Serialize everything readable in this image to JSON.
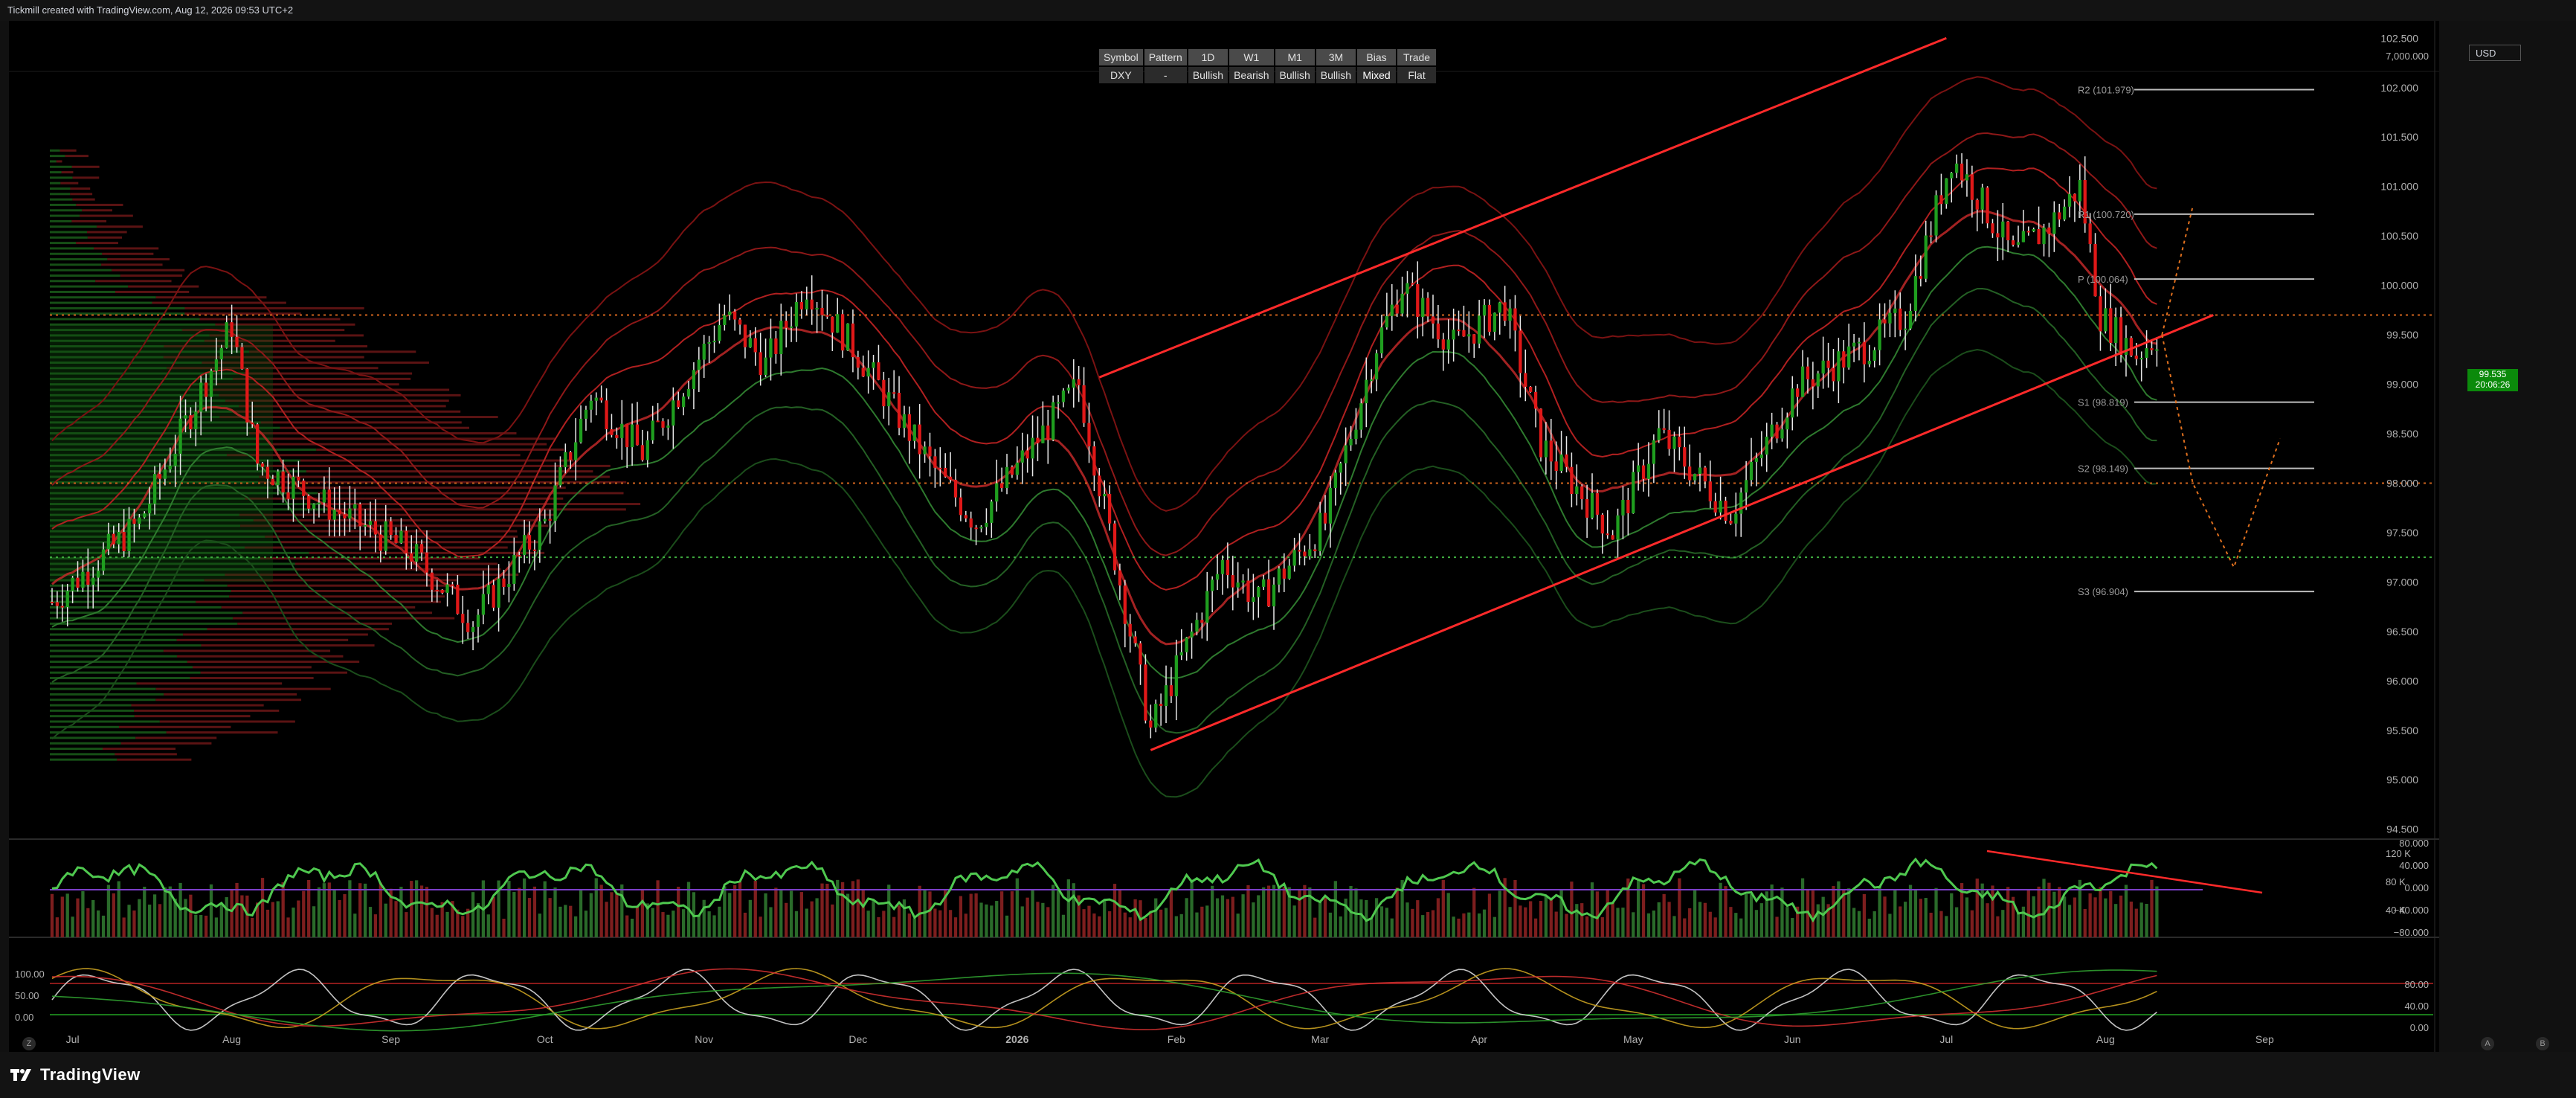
{
  "header": {
    "text": "Tickmill created with TradingView.com, Aug 12, 2026 09:53 UTC+2"
  },
  "table": {
    "headers": [
      "Symbol",
      "Pattern",
      "1D",
      "W1",
      "M1",
      "3M",
      "Bias",
      "Trade"
    ],
    "values": [
      "DXY",
      "-",
      "Bullish",
      "Bearish",
      "Bullish",
      "Bullish",
      "Mixed",
      "Flat"
    ],
    "value_status": [
      "neutral",
      "neutral",
      "bull",
      "bear",
      "bull",
      "bull",
      "mixed",
      "neutral"
    ]
  },
  "price_axis": {
    "currency": "USD",
    "top_label": "7,000.000",
    "ticks": [
      "102.500",
      "102.000",
      "101.500",
      "101.000",
      "100.500",
      "100.000",
      "99.500",
      "99.000",
      "98.500",
      "98.000",
      "97.500",
      "97.000",
      "96.500",
      "96.000",
      "95.500",
      "95.000",
      "94.500"
    ],
    "current_price": "99.535",
    "countdown": "20:06:26"
  },
  "pivots": [
    {
      "label": "R2 (101.979)",
      "value": 101.979
    },
    {
      "label": "R1 (100.720)",
      "value": 100.72
    },
    {
      "label": "P (100.064)",
      "value": 100.064
    },
    {
      "label": "S1 (98.819)",
      "value": 98.819
    },
    {
      "label": "S2 (98.149)",
      "value": 98.149
    },
    {
      "label": "S3 (96.904)",
      "value": 96.904
    }
  ],
  "volume_axis": {
    "ticks": [
      "120 K",
      "80 K",
      "40 K"
    ]
  },
  "rsi_axis": {
    "ticks": [
      "80.000",
      "40.000",
      "0.000",
      "−40.000",
      "−80.000"
    ]
  },
  "stoch_axis": {
    "left_ticks": [
      "100.00",
      "50.00",
      "0.00"
    ],
    "right_ticks": [
      "80.00",
      "40.00",
      "0.00"
    ]
  },
  "time_axis": {
    "labels": [
      "Jul",
      "Aug",
      "Sep",
      "Oct",
      "Nov",
      "Dec",
      "2026",
      "Feb",
      "Mar",
      "Apr",
      "May",
      "Jun",
      "Jul",
      "Aug",
      "Sep"
    ]
  },
  "footer": {
    "brand": "TradingView",
    "z_button": "Z",
    "a_button": "A",
    "b_button": "B"
  },
  "colors": {
    "bull": "#1f9e1f",
    "bear": "#e01818",
    "channel": "#ff2a2a",
    "hline_orange": "#d0641e",
    "hline_green": "#3fae3f",
    "pivot_line": "#9a9a9a",
    "bg": "#000000"
  },
  "chart_data": {
    "type": "candlestick",
    "symbol": "DXY",
    "xlabel": "",
    "ylabel": "",
    "ylim": [
      94.4,
      102.6
    ],
    "last_price": 99.535,
    "close_path": [
      {
        "date": "2025-06-27",
        "close": 96.8
      },
      {
        "date": "2025-07-14",
        "close": 97.6
      },
      {
        "date": "2025-08-01",
        "close": 99.6
      },
      {
        "date": "2025-08-06",
        "close": 98.2
      },
      {
        "date": "2025-08-22",
        "close": 97.7
      },
      {
        "date": "2025-09-05",
        "close": 97.3
      },
      {
        "date": "2025-09-17",
        "close": 96.6
      },
      {
        "date": "2025-10-01",
        "close": 97.6
      },
      {
        "date": "2025-10-10",
        "close": 98.9
      },
      {
        "date": "2025-10-20",
        "close": 98.3
      },
      {
        "date": "2025-11-05",
        "close": 99.7
      },
      {
        "date": "2025-11-13",
        "close": 99.2
      },
      {
        "date": "2025-11-21",
        "close": 100.0
      },
      {
        "date": "2025-12-01",
        "close": 99.3
      },
      {
        "date": "2025-12-15",
        "close": 98.2
      },
      {
        "date": "2025-12-24",
        "close": 97.6
      },
      {
        "date": "2026-01-13",
        "close": 99.0
      },
      {
        "date": "2026-01-27",
        "close": 95.5
      },
      {
        "date": "2026-02-10",
        "close": 97.2
      },
      {
        "date": "2026-02-17",
        "close": 96.8
      },
      {
        "date": "2026-03-02",
        "close": 97.6
      },
      {
        "date": "2026-03-12",
        "close": 99.4
      },
      {
        "date": "2026-03-17",
        "close": 100.0
      },
      {
        "date": "2026-03-27",
        "close": 99.4
      },
      {
        "date": "2026-04-06",
        "close": 99.8
      },
      {
        "date": "2026-04-13",
        "close": 98.4
      },
      {
        "date": "2026-04-27",
        "close": 97.5
      },
      {
        "date": "2026-05-06",
        "close": 98.5
      },
      {
        "date": "2026-05-20",
        "close": 97.7
      },
      {
        "date": "2026-06-02",
        "close": 99.0
      },
      {
        "date": "2026-06-16",
        "close": 99.4
      },
      {
        "date": "2026-06-23",
        "close": 99.7
      },
      {
        "date": "2026-07-02",
        "close": 101.3
      },
      {
        "date": "2026-07-06",
        "close": 101.0
      },
      {
        "date": "2026-07-14",
        "close": 100.3
      },
      {
        "date": "2026-07-21",
        "close": 100.6
      },
      {
        "date": "2026-07-27",
        "close": 101.0
      },
      {
        "date": "2026-07-31",
        "close": 99.7
      },
      {
        "date": "2026-08-07",
        "close": 99.3
      },
      {
        "date": "2026-08-12",
        "close": 99.535
      }
    ],
    "channel": {
      "upper": [
        {
          "date": "2026-01-17",
          "value": 99.07
        },
        {
          "date": "2026-07-01",
          "value": 102.5
        }
      ],
      "lower": [
        {
          "date": "2026-01-27",
          "value": 95.3
        },
        {
          "date": "2026-08-22",
          "value": 99.7
        }
      ]
    },
    "horizontal_levels": [
      {
        "value": 99.7,
        "style": "dotted",
        "color": "orange"
      },
      {
        "value": 98.0,
        "style": "dotted",
        "color": "orange"
      },
      {
        "value": 97.25,
        "style": "dotted",
        "color": "green"
      }
    ],
    "projection": [
      {
        "date": "2026-08-12",
        "value": 99.5
      },
      {
        "date": "2026-08-18",
        "value": 98.0
      },
      {
        "date": "2026-08-26",
        "value": 97.15
      },
      {
        "date": "2026-09-04",
        "value": 98.45
      }
    ]
  }
}
